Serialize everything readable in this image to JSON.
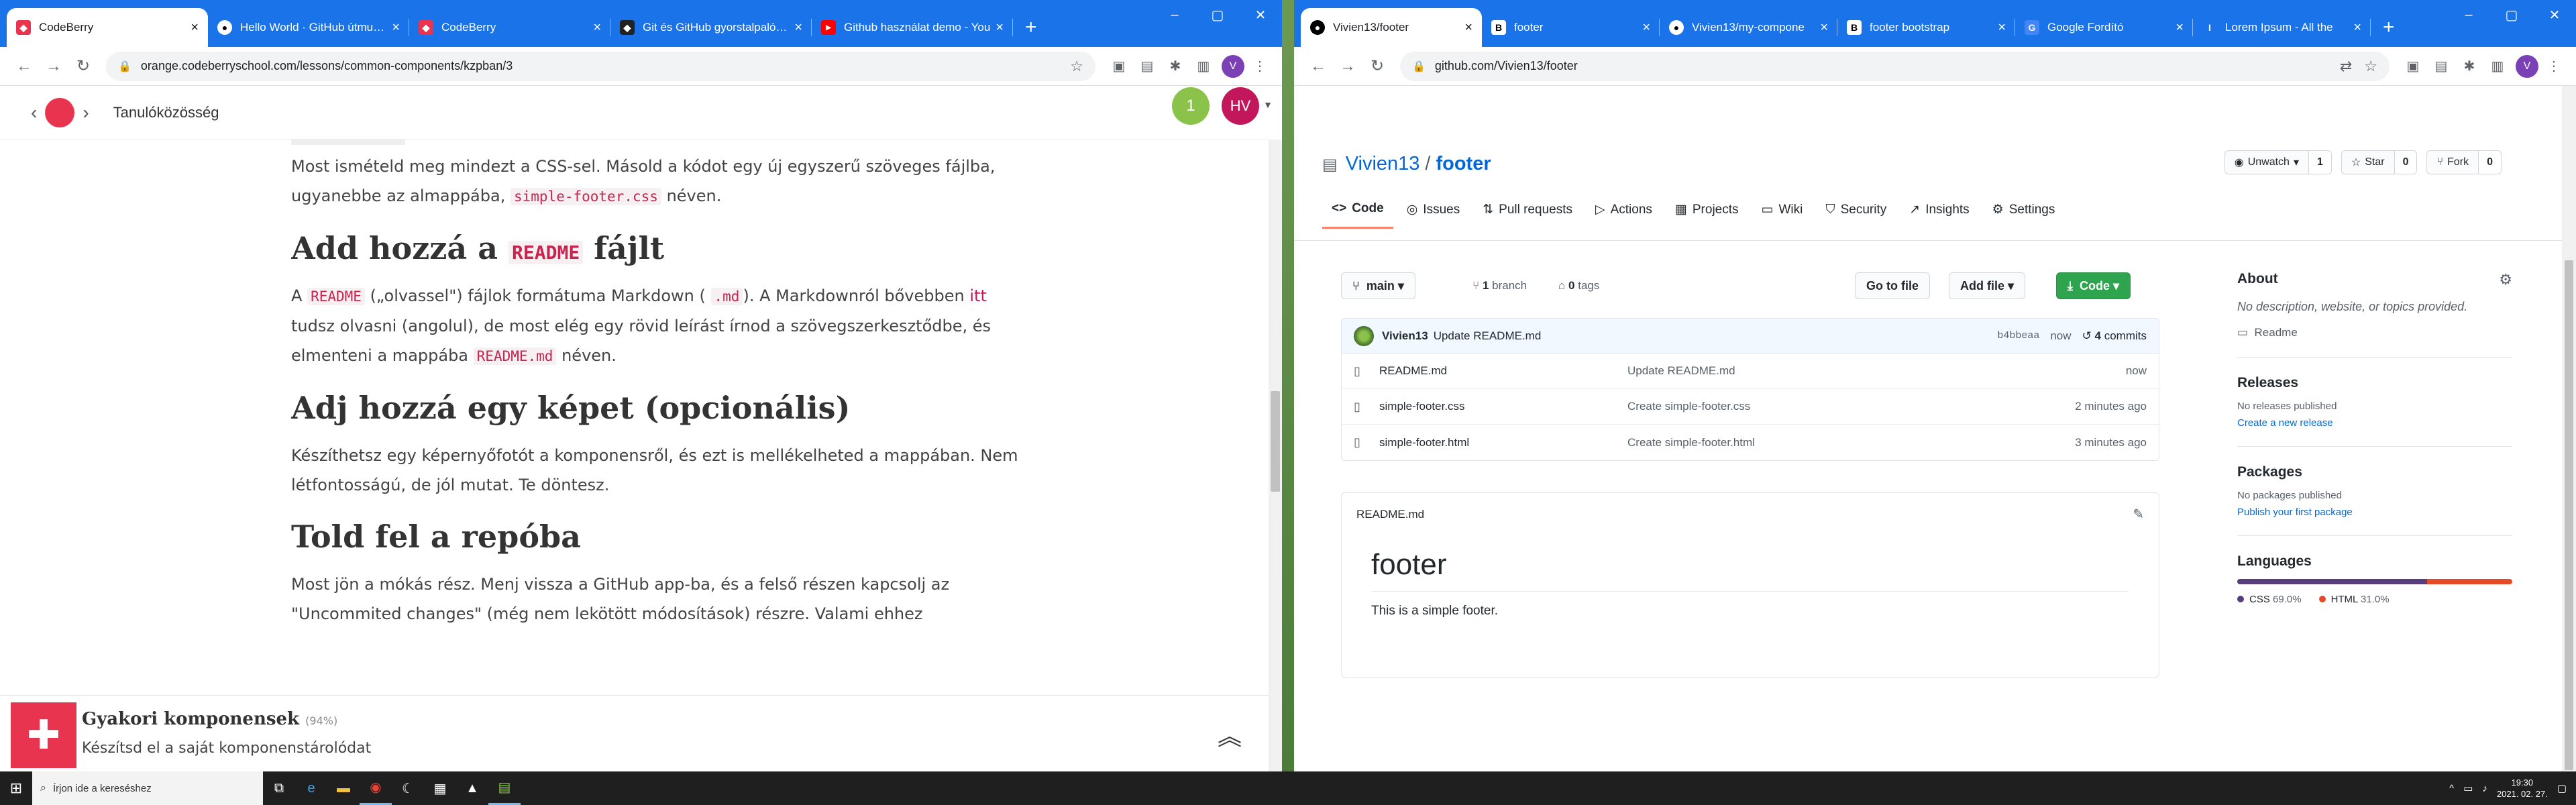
{
  "left": {
    "tabs": [
      {
        "title": "CodeBerry",
        "icon": "codeberry-icon",
        "active": true
      },
      {
        "title": "Hello World · GitHub útmutató",
        "icon": "github-icon"
      },
      {
        "title": "CodeBerry",
        "icon": "codeberry-icon"
      },
      {
        "title": "Git és GitHub gyorstalpaló · A",
        "icon": "codeberry-icon"
      },
      {
        "title": "Github használat demo - You",
        "icon": "youtube-icon"
      }
    ],
    "url": "orange.codeberryschool.com/lessons/common-components/kzpban/3",
    "avatar": "V",
    "header": {
      "community": "Tanulóközösség",
      "badge": "1",
      "user": "HV"
    },
    "content": {
      "p1_a": "Most ismételd meg mindezt a CSS-sel. Másold a kódot egy új egyszerű szöveges fájlba, ugyanebbe az almappába,",
      "p1_code": "simple-footer.css",
      "p1_b": "néven.",
      "h2_a": "Add hozzá a",
      "h2_code": "README",
      "h2_b": "fájlt",
      "p2_a": "A",
      "p2_code1": "README",
      "p2_b": "(„olvassel\") fájlok formátuma Markdown (",
      "p2_code2": ".md",
      "p2_c": "). A Markdownról bővebben",
      "p2_link": "itt",
      "p2_d": "tudsz olvasni (angolul), de most elég egy rövid leírást írnod a szövegszerkesztődbe, és elmenteni a mappába",
      "p2_code3": "README.md",
      "p2_e": "néven.",
      "h3": "Adj hozzá egy képet (opcionális)",
      "p3": "Készíthetsz egy képernyőfotót a komponensről, és ezt is mellékelheted a mappában. Nem létfontosságú, de jól mutat. Te döntesz.",
      "h4": "Told fel a repóba",
      "p4": "Most jön a mókás rész. Menj vissza a GitHub app-ba, és a felső részen kapcsolj az \"Uncommited changes\" (még nem lekötött módosítások) részre. Valami ehhez"
    },
    "bottom": {
      "title": "Gyakori komponensek",
      "percent": "(94%)",
      "subtitle": "Készítsd el a saját komponenstárolódat"
    }
  },
  "right": {
    "tabs": [
      {
        "title": "Vivien13/footer",
        "icon": "github-icon",
        "active": true
      },
      {
        "title": "footer",
        "icon": "bootstrap-icon"
      },
      {
        "title": "Vivien13/my-compone",
        "icon": "github-icon"
      },
      {
        "title": "footer bootstrap",
        "icon": "bootstrap-icon"
      },
      {
        "title": "Google Fordító",
        "icon": "translate-icon"
      },
      {
        "title": "Lorem Ipsum - All the",
        "icon": "lorem-icon"
      }
    ],
    "url": "github.com/Vivien13/footer",
    "avatar": "V",
    "repo": {
      "owner": "Vivien13",
      "sep": "/",
      "name": "footer"
    },
    "actions": {
      "unwatch": "Unwatch",
      "unwatch_count": "1",
      "star": "Star",
      "star_count": "0",
      "fork": "Fork",
      "fork_count": "0"
    },
    "nav_tabs": [
      {
        "label": "Code",
        "icon": "code-icon",
        "selected": true
      },
      {
        "label": "Issues",
        "icon": "issue-icon"
      },
      {
        "label": "Pull requests",
        "icon": "pull-request-icon"
      },
      {
        "label": "Actions",
        "icon": "play-icon"
      },
      {
        "label": "Projects",
        "icon": "project-icon"
      },
      {
        "label": "Wiki",
        "icon": "book-icon"
      },
      {
        "label": "Security",
        "icon": "shield-icon"
      },
      {
        "label": "Insights",
        "icon": "graph-icon"
      },
      {
        "label": "Settings",
        "icon": "gear-icon"
      }
    ],
    "branch": {
      "name": "main",
      "branches_count": "1",
      "branches_label": "branch",
      "tags_count": "0",
      "tags_label": "tags"
    },
    "buttons": {
      "go_to_file": "Go to file",
      "add_file": "Add file",
      "code": "Code"
    },
    "commit": {
      "author": "Vivien13",
      "message": "Update README.md",
      "sha": "b4bbeaa",
      "time": "now",
      "count": "4",
      "count_label": "commits"
    },
    "files": [
      {
        "name": "README.md",
        "message": "Update README.md",
        "time": "now"
      },
      {
        "name": "simple-footer.css",
        "message": "Create simple-footer.css",
        "time": "2 minutes ago"
      },
      {
        "name": "simple-footer.html",
        "message": "Create simple-footer.html",
        "time": "3 minutes ago"
      }
    ],
    "readme": {
      "filename": "README.md",
      "heading": "footer",
      "text": "This is a simple footer."
    },
    "about": {
      "title": "About",
      "desc": "No description, website, or topics provided.",
      "readme": "Readme"
    },
    "releases": {
      "title": "Releases",
      "none": "No releases published",
      "create": "Create a new release"
    },
    "packages": {
      "title": "Packages",
      "none": "No packages published",
      "publish": "Publish your first package"
    },
    "languages": {
      "title": "Languages",
      "items": [
        {
          "name": "CSS",
          "pct": "69.0%",
          "value": 69.0,
          "color": "#563d7c"
        },
        {
          "name": "HTML",
          "pct": "31.0%",
          "value": 31.0,
          "color": "#e34c26"
        }
      ]
    }
  },
  "taskbar": {
    "search_placeholder": "Írjon ide a kereséshez",
    "time": "19:30",
    "date": "2021. 02. 27."
  }
}
